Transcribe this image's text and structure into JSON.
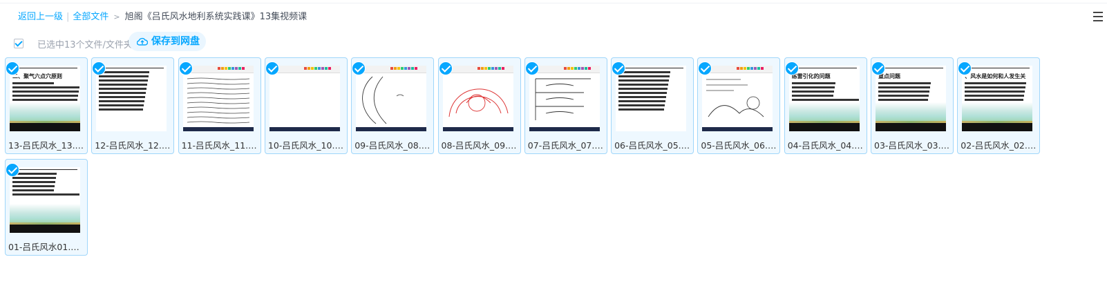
{
  "breadcrumb": {
    "back": "返回上一级",
    "sep": "|",
    "all_files": "全部文件",
    "arrow": ">",
    "current": "旭阁《吕氏风水地利系统实践课》13集视频课"
  },
  "toolbar": {
    "selected_text": "已选中13个文件/文件夹",
    "save_label": "保存到网盘"
  },
  "icons": {
    "menu": "list-menu-icon",
    "save": "cloud-upload-icon",
    "check": "check-circle-icon"
  },
  "colors": {
    "accent": "#06a7ff",
    "card_border": "#9fd6fa",
    "card_bg": "#eef8ff"
  },
  "files": [
    {
      "name": "13-吕氏风水_13.m...",
      "thumb": "slide",
      "title": "二、聚气六点穴原则"
    },
    {
      "name": "12-吕氏风水_12.m...",
      "thumb": "slide-text",
      "title": ""
    },
    {
      "name": "11-吕氏风水_11.m...",
      "thumb": "doc-text",
      "title": ""
    },
    {
      "name": "10-吕氏风水_10.m...",
      "thumb": "doc-blank",
      "title": ""
    },
    {
      "name": "09-吕氏风水_08.m...",
      "thumb": "doc-sketch",
      "title": ""
    },
    {
      "name": "08-吕氏风水_09.m...",
      "thumb": "doc-red",
      "title": ""
    },
    {
      "name": "07-吕氏风水_07.m...",
      "thumb": "doc-sketch2",
      "title": ""
    },
    {
      "name": "06-吕氏风水_05.m...",
      "thumb": "slide-text",
      "title": ""
    },
    {
      "name": "05-吕氏风水_06.m...",
      "thumb": "doc-sketch3",
      "title": ""
    },
    {
      "name": "04-吕氏风水_04.m...",
      "thumb": "slide",
      "title": "练雷引化的问题"
    },
    {
      "name": "03-吕氏风水_03.m...",
      "thumb": "slide",
      "title": "重点问题"
    },
    {
      "name": "02-吕氏风水_02.m...",
      "thumb": "slide",
      "title": "、风水是如何和人发生关"
    },
    {
      "name": "01-吕氏风水01.mp...",
      "thumb": "slide",
      "title": ""
    }
  ]
}
